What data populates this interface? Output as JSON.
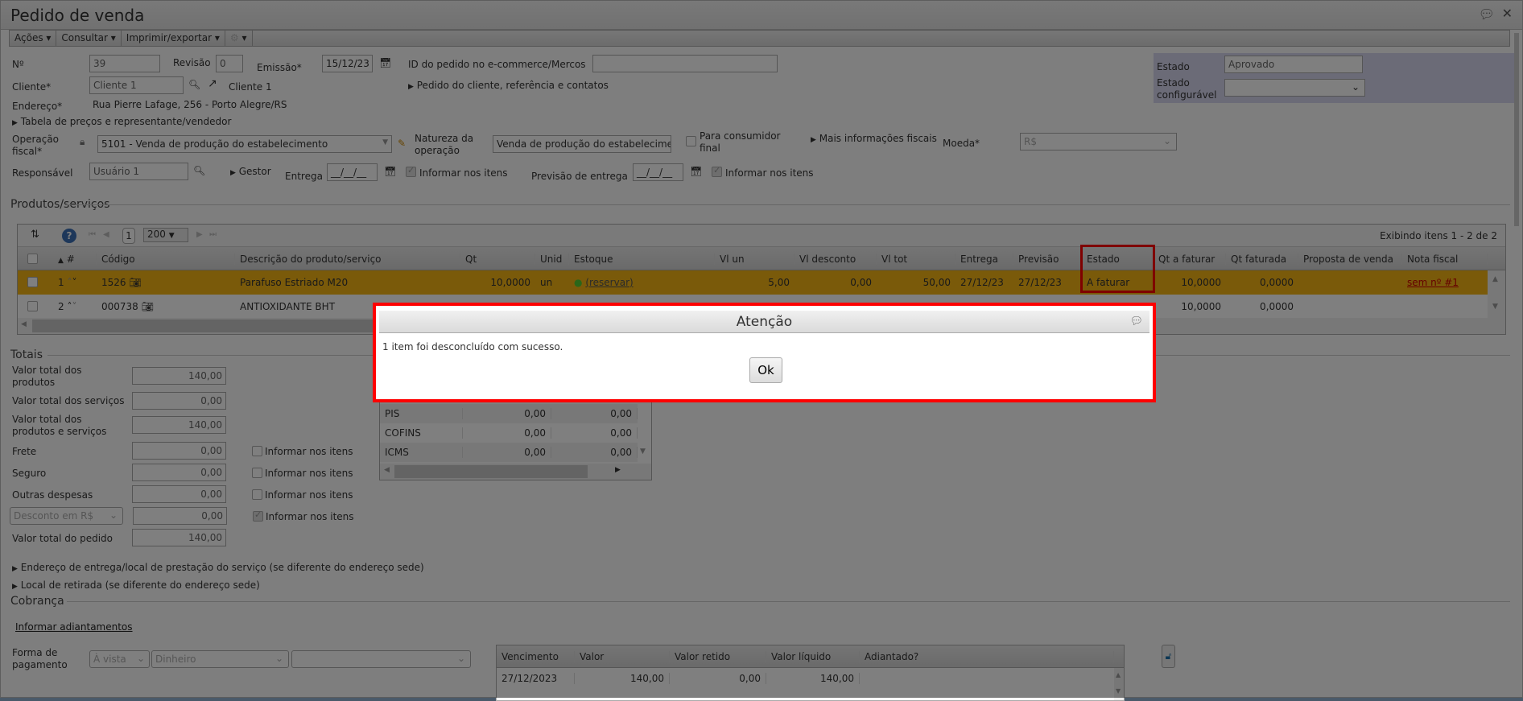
{
  "window": {
    "title": "Pedido de venda"
  },
  "toolbar": {
    "acoes": "Ações ▾",
    "consultar": "Consultar ▾",
    "imprimir": "Imprimir/exportar ▾",
    "settings_caret": "▾"
  },
  "form": {
    "numero_label": "Nº",
    "numero": "39",
    "revisao_label": "Revisão",
    "revisao": "0",
    "emissao_label": "Emissão*",
    "emissao": "15/12/23",
    "id_ecommerce_label": "ID do pedido no e-commerce/Mercos",
    "id_ecommerce": "",
    "cliente_label": "Cliente*",
    "cliente": "Cliente 1",
    "cliente_link": "Cliente 1",
    "pedido_cliente": "Pedido do cliente, referência e contatos",
    "endereco_label": "Endereço*",
    "endereco": "Rua Pierre Lafage, 256 - Porto Alegre/RS",
    "tabela_precos": "Tabela de preços e representante/vendedor",
    "operacao_label": "Operação fiscal*",
    "operacao": "5101 - Venda de produção do estabelecimento",
    "natureza_label": "Natureza da operação",
    "natureza": "Venda de produção do estabelecimento",
    "consumidor_final": "Para consumidor final",
    "mais_info": "Mais informações fiscais",
    "moeda_label": "Moeda*",
    "moeda": "R$",
    "responsavel_label": "Responsável",
    "responsavel": "Usuário 1",
    "gestor": "Gestor",
    "entrega_label": "Entrega",
    "entrega": "__/__/__",
    "informar_itens": "Informar nos itens",
    "previsao_label": "Previsão de entrega",
    "previsao": "__/__/__",
    "estado_label": "Estado",
    "estado": "Aprovado",
    "estado_config_label": "Estado configurável",
    "estado_config": ""
  },
  "produtos": {
    "legend": "Produtos/serviços",
    "page": "1",
    "page_size": "200",
    "exibindo": "Exibindo itens 1 - 2 de 2",
    "columns": [
      "#",
      "Código",
      "Descrição do produto/serviço",
      "Qt",
      "Unid",
      "Estoque",
      "Vl un",
      "Vl desconto",
      "Vl tot",
      "Entrega",
      "Previsão",
      "Estado",
      "Qt a faturar",
      "Qt faturada",
      "Proposta de venda",
      "Nota fiscal"
    ],
    "rows": [
      {
        "n": "1",
        "codigo": "1526",
        "descricao": "Parafuso Estriado M20",
        "qt": "10,0000",
        "unid": "un",
        "estoque": "(reservar)",
        "vl_un": "5,00",
        "vl_desc": "0,00",
        "vl_tot": "50,00",
        "entrega": "27/12/23",
        "previsao": "27/12/23",
        "estado": "A faturar",
        "qt_faturar": "10,0000",
        "qt_faturada": "0,0000",
        "proposta": "",
        "nota": "sem nº #1"
      },
      {
        "n": "2",
        "codigo": "000738",
        "descricao": "ANTIOXIDANTE BHT",
        "qt_faturar": "10,0000",
        "qt_faturada": "0,0000"
      }
    ]
  },
  "dialog": {
    "title": "Atenção",
    "message": "1 item foi desconcluído com sucesso.",
    "ok": "Ok"
  },
  "totais": {
    "legend": "Totais",
    "rows": [
      {
        "label": "Valor total dos produtos",
        "value": "140,00"
      },
      {
        "label": "Valor total dos serviços",
        "value": "0,00"
      },
      {
        "label": "Valor total dos produtos e serviços",
        "value": "140,00"
      },
      {
        "label": "Frete",
        "value": "0,00",
        "check": "Informar nos itens"
      },
      {
        "label": "Seguro",
        "value": "0,00",
        "check": "Informar nos itens"
      },
      {
        "label": "Outras despesas",
        "value": "0,00",
        "check": "Informar nos itens"
      },
      {
        "label": "Desconto em R$",
        "value": "0,00",
        "check": "Informar nos itens"
      },
      {
        "label": "Valor total do pedido",
        "value": "140,00"
      }
    ],
    "impostos": [
      {
        "name": "PIS",
        "v1": "0,00",
        "v2": "0,00"
      },
      {
        "name": "COFINS",
        "v1": "0,00",
        "v2": "0,00"
      },
      {
        "name": "ICMS",
        "v1": "0,00",
        "v2": "0,00"
      }
    ]
  },
  "endereco_entrega": "Endereço de entrega/local de prestação do serviço (se diferente do endereço sede)",
  "local_retirada": "Local de retirada (se diferente do endereço sede)",
  "cobranca": {
    "legend": "Cobrança",
    "adiantamentos": "Informar adiantamentos",
    "forma_label": "Forma de pagamento",
    "condicao": "À vista",
    "meio": "Dinheiro",
    "extra": "",
    "columns": [
      "Vencimento",
      "Valor",
      "Valor retido",
      "Valor líquido",
      "Adiantado?"
    ],
    "rows": [
      {
        "vencimento": "27/12/2023",
        "valor": "140,00",
        "retido": "0,00",
        "liquido": "140,00",
        "adiantado": ""
      }
    ]
  }
}
